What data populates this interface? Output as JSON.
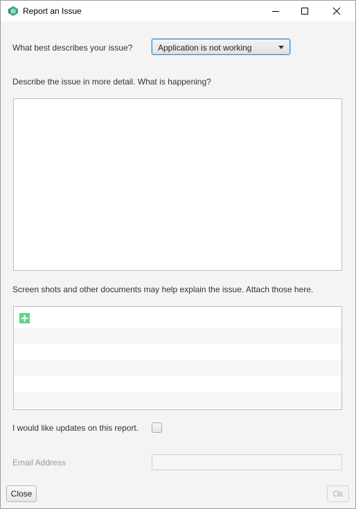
{
  "window": {
    "title": "Report an Issue"
  },
  "issue_type": {
    "label": "What best describes your issue?",
    "selected": "Application is not working"
  },
  "details": {
    "label": "Describe the issue in more detail. What is happening?",
    "value": ""
  },
  "attachments": {
    "label": "Screen shots and other documents may help explain the issue. Attach those here.",
    "items": []
  },
  "updates": {
    "label": "I would like updates on this report.",
    "checked": false
  },
  "email": {
    "label": "Email Address",
    "value": ""
  },
  "buttons": {
    "close": "Close",
    "ok": "Ok"
  },
  "colors": {
    "accent": "#3c8fd2",
    "add_icon": "#5cd48a"
  },
  "icons": [
    "app-icon",
    "minimize-icon",
    "maximize-icon",
    "close-icon",
    "add-icon",
    "dropdown-caret-icon"
  ]
}
